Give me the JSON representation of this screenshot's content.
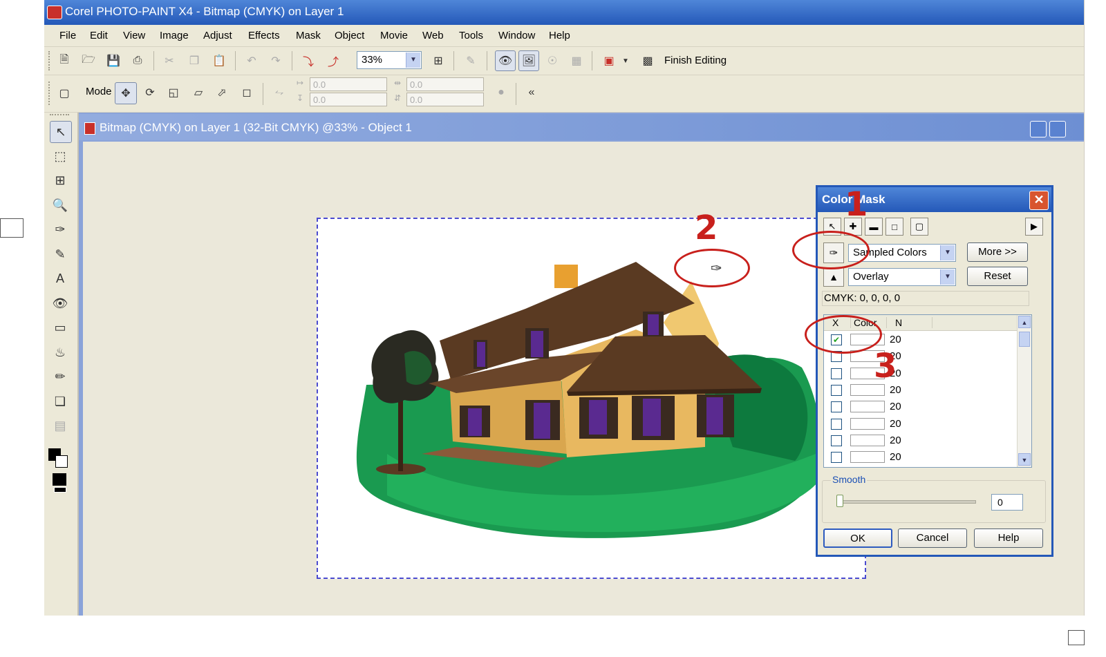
{
  "window": {
    "title": "Corel PHOTO-PAINT X4 - Bitmap (CMYK) on Layer 1"
  },
  "menu": [
    "File",
    "Edit",
    "View",
    "Image",
    "Adjust",
    "Effects",
    "Mask",
    "Object",
    "Movie",
    "Web",
    "Tools",
    "Window",
    "Help"
  ],
  "toolbar": {
    "zoom": "33%",
    "finish_editing": "Finish Editing"
  },
  "property_bar": {
    "mode_label": "Mode",
    "x": "0.0",
    "y": "0.0",
    "w": "0.0",
    "h": "0.0"
  },
  "document": {
    "title": "Bitmap (CMYK) on Layer 1 (32-Bit CMYK) @33% - Object 1"
  },
  "dialog": {
    "title": "Color Mask",
    "mode_select": "Sampled Colors",
    "view_select": "Overlay",
    "more_button": "More >>",
    "reset_button": "Reset",
    "cmyk_readout": "CMYK:  0, 0, 0, 0",
    "list_headers": {
      "x": "X",
      "color": "Color",
      "n": "N"
    },
    "rows": [
      {
        "checked": true,
        "n": "20"
      },
      {
        "checked": false,
        "n": "20"
      },
      {
        "checked": false,
        "n": "20"
      },
      {
        "checked": false,
        "n": "20"
      },
      {
        "checked": false,
        "n": "20"
      },
      {
        "checked": false,
        "n": "20"
      },
      {
        "checked": false,
        "n": "20"
      },
      {
        "checked": false,
        "n": "20"
      }
    ],
    "smooth_label": "Smooth",
    "smooth_value": "0",
    "ok_button": "OK",
    "cancel_button": "Cancel",
    "help_button": "Help"
  },
  "annotations": {
    "one": "1",
    "two": "2",
    "three": "3"
  },
  "colors": {
    "titlebar": "#2458b8",
    "annotation": "#c8201c",
    "roof": "#5a3a22",
    "walls": "#e8b860",
    "lawn": "#1a9a50"
  }
}
